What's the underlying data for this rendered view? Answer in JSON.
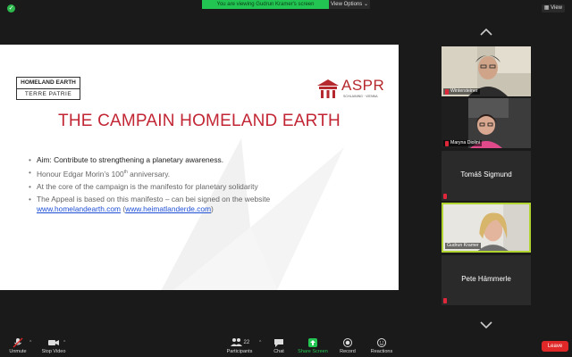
{
  "top_bar": {
    "share_message": "You are viewing Gudrun Kramer's screen",
    "view_options_label": "View Options ⌄",
    "view_label": "View"
  },
  "slide": {
    "logo_line1": "HOMELAND EARTH",
    "logo_line2": "TERRE PATRIE",
    "org_name": "ASPR",
    "org_subtitle": "SCHLAINING · VIENNA",
    "title": "THE CAMPAIN HOMELAND EARTH",
    "bullets": {
      "b1": "Aim: Contribute to strengthening a planetary awareness.",
      "b2_pre": "Honour Edgar Morin’s 100",
      "b2_sup": "th",
      "b2_post": " anniversary.",
      "b3": "At the core of the campaign is the manifesto for planetary solidarity",
      "b4_text": "The Appeal is based on this manifesto – can bei signed on the website",
      "b4_link1": "www.homelandearth.com",
      "b4_mid": " (",
      "b4_link2": "www.heimatlanderde.com",
      "b4_end": ")"
    }
  },
  "participants": {
    "p1": "Wintersteiner",
    "p2": "Maryna Diolini",
    "p3": "Tomáš Sigmund",
    "p4": "Gudrun Kramer",
    "p5": "Pete Hämmerle"
  },
  "toolbar": {
    "unmute": "Unmute",
    "stop_video": "Stop Video",
    "participants": "Participants",
    "participants_count": "22",
    "chat": "Chat",
    "share_screen": "Share Screen",
    "record": "Record",
    "reactions": "Reactions",
    "leave": "Leave"
  },
  "colors": {
    "accent_green": "#23c552",
    "title_red": "#c22634",
    "leave_red": "#e02828",
    "active_speaker": "#b2d431"
  }
}
